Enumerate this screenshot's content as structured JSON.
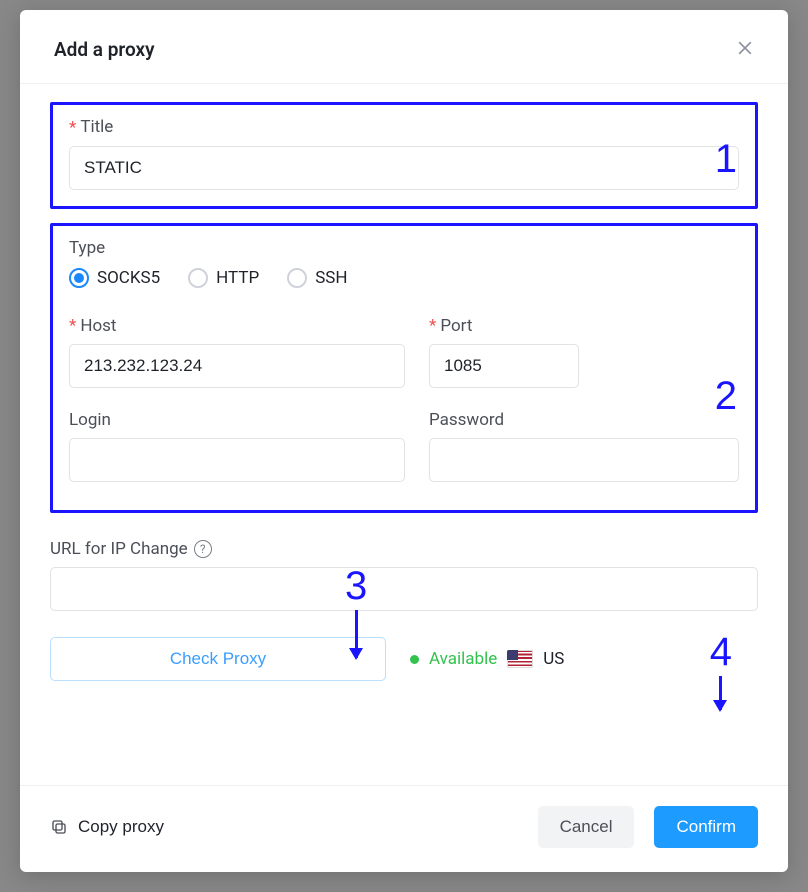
{
  "header": {
    "title": "Add a proxy"
  },
  "annotations": {
    "one": "1",
    "two": "2",
    "three": "3",
    "four": "4"
  },
  "title_section": {
    "label": "Title",
    "value": "STATIC"
  },
  "type_section": {
    "label": "Type",
    "options": [
      {
        "label": "SOCKS5",
        "selected": true
      },
      {
        "label": "HTTP",
        "selected": false
      },
      {
        "label": "SSH",
        "selected": false
      }
    ]
  },
  "host": {
    "label": "Host",
    "value": "213.232.123.24"
  },
  "port": {
    "label": "Port",
    "value": "1085"
  },
  "login": {
    "label": "Login",
    "value": ""
  },
  "password": {
    "label": "Password",
    "value": ""
  },
  "ipchange": {
    "label": "URL for IP Change",
    "value": ""
  },
  "check": {
    "button": "Check Proxy"
  },
  "status": {
    "text": "Available",
    "country": "US"
  },
  "footer": {
    "copy": "Copy proxy",
    "cancel": "Cancel",
    "confirm": "Confirm"
  }
}
